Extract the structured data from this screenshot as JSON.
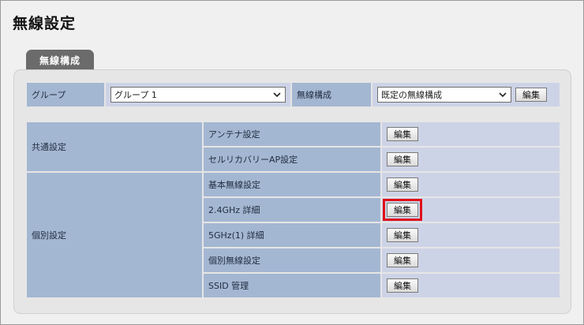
{
  "page": {
    "title": "無線設定"
  },
  "tab": {
    "label": "無線構成"
  },
  "group_row": {
    "group_label": "グループ",
    "group_select": "グループ 1",
    "config_label": "無線構成",
    "config_select": "既定の無線構成",
    "edit_button": "編集"
  },
  "sections": [
    {
      "label": "共通設定",
      "items": [
        {
          "name": "アンテナ設定",
          "button": "編集"
        },
        {
          "name": "セルリカバリーAP設定",
          "button": "編集"
        }
      ]
    },
    {
      "label": "個別設定",
      "items": [
        {
          "name": "基本無線設定",
          "button": "編集"
        },
        {
          "name": "2.4GHz 詳細",
          "button": "編集",
          "highlighted": true
        },
        {
          "name": "5GHz(1) 詳細",
          "button": "編集"
        },
        {
          "name": "個別無線設定",
          "button": "編集"
        },
        {
          "name": "SSID 管理",
          "button": "編集"
        }
      ]
    }
  ],
  "colors": {
    "label_bg": "#a4b7d2",
    "value_bg": "#cdd3e6",
    "highlight": "#e0111a",
    "tab_bg": "#6b6b6b"
  }
}
